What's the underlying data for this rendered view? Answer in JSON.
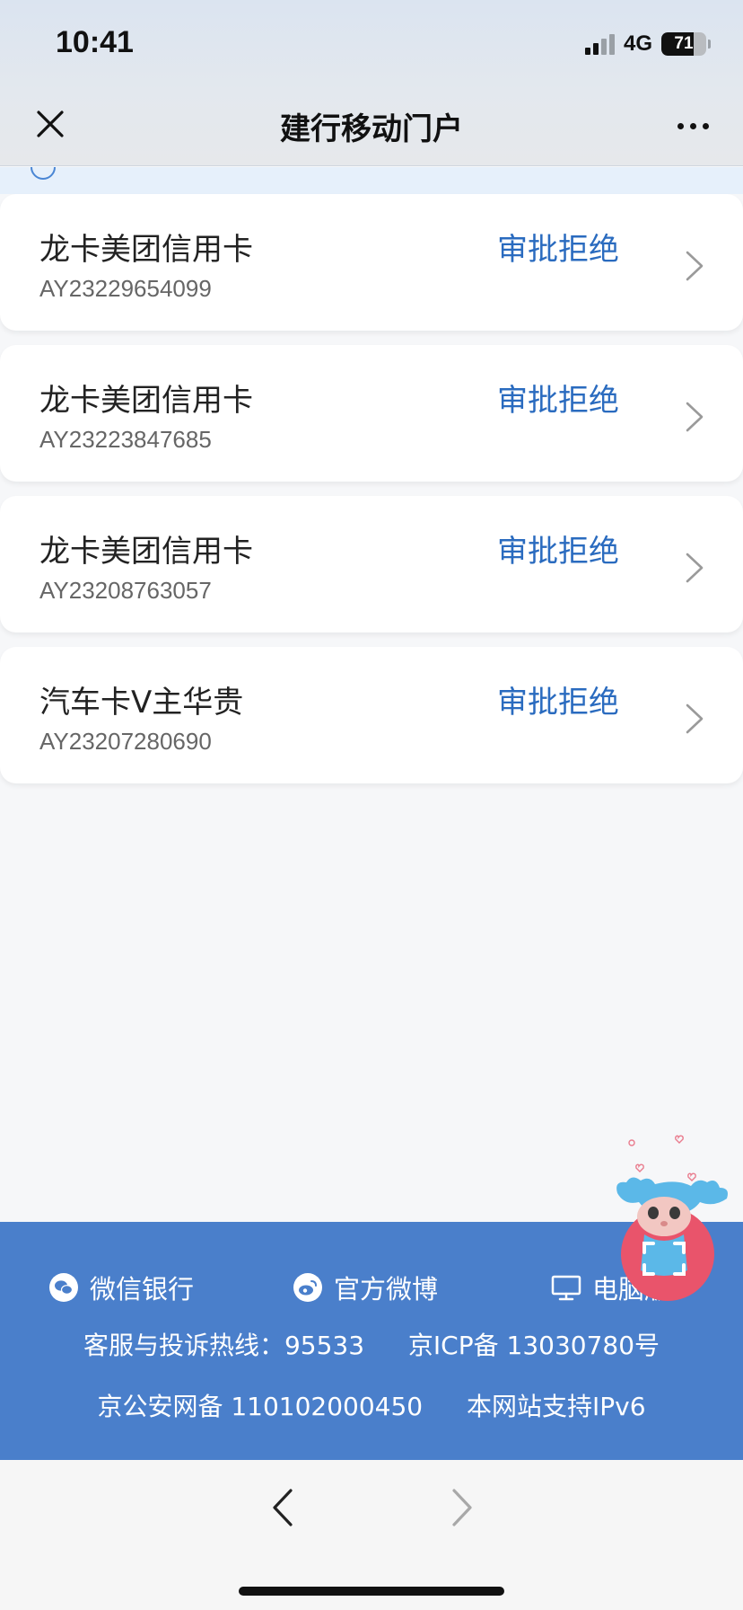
{
  "status_bar": {
    "time": "10:41",
    "network": "4G",
    "battery": "71",
    "battery_level": 0.71,
    "signal_bars_active": 2,
    "signal_bars_total": 4
  },
  "nav": {
    "title": "建行移动门户",
    "close_icon": "close-icon",
    "more_icon": "more-icon"
  },
  "applications": [
    {
      "name": "龙卡美团信用卡",
      "number": "AY23229654099",
      "status": "审批拒绝"
    },
    {
      "name": "龙卡美团信用卡",
      "number": "AY23223847685",
      "status": "审批拒绝"
    },
    {
      "name": "龙卡美团信用卡",
      "number": "AY23208763057",
      "status": "审批拒绝"
    },
    {
      "name": "汽车卡V主华贵",
      "number": "AY23207280690",
      "status": "审批拒绝"
    }
  ],
  "footer": {
    "links": [
      {
        "label": "微信银行",
        "icon": "wechat-icon"
      },
      {
        "label": "官方微博",
        "icon": "weibo-icon"
      },
      {
        "label": "电脑版",
        "icon": "desktop-icon"
      }
    ],
    "hotline": "客服与投诉热线：95533",
    "icp": "京ICP备 13030780号",
    "police": "京公安网备 110102000450",
    "ipv6": "本网站支持IPv6"
  },
  "colors": {
    "accent": "#2a6bbf",
    "footer_bg": "#4a7fcb",
    "header_bg": "#e3e8ee"
  }
}
